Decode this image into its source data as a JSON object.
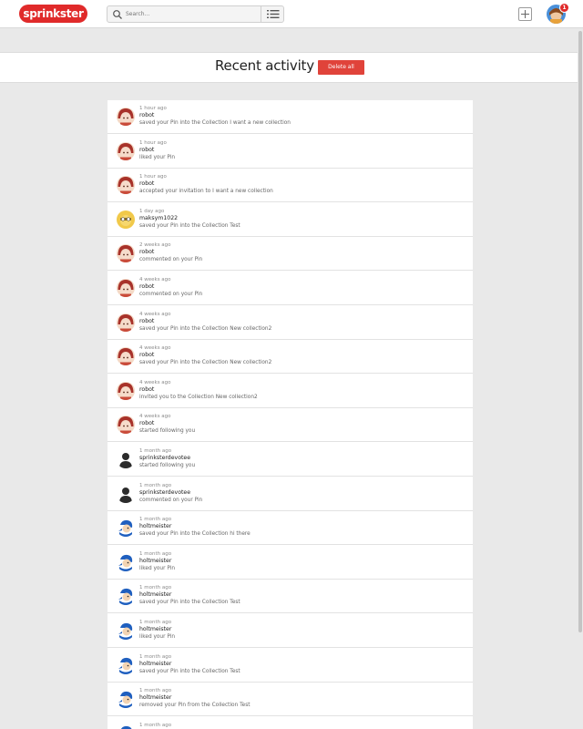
{
  "header": {
    "logo": "sprinkster",
    "search_placeholder": "Search...",
    "notification_count": "1"
  },
  "page": {
    "title": "Recent activity",
    "delete_all_label": "Delete all"
  },
  "activities": [
    {
      "time": "1 hour ago",
      "user": "robot",
      "action": "saved your Pin into the Collection I want a new collection",
      "avatar": "robot-avatar"
    },
    {
      "time": "1 hour ago",
      "user": "robot",
      "action": "liked your Pin",
      "avatar": "robot-avatar"
    },
    {
      "time": "1 hour ago",
      "user": "robot",
      "action": "accepted your invitation to I want a new collection",
      "avatar": "robot-avatar"
    },
    {
      "time": "1 day ago",
      "user": "maksym1022",
      "action": "saved your Pin into the Collection Test",
      "avatar": "maksym-avatar"
    },
    {
      "time": "2 weeks ago",
      "user": "robot",
      "action": "commented on your Pin",
      "avatar": "robot-avatar"
    },
    {
      "time": "4 weeks ago",
      "user": "robot",
      "action": "commented on your Pin",
      "avatar": "robot-avatar"
    },
    {
      "time": "4 weeks ago",
      "user": "robot",
      "action": "saved your Pin into the Collection New collection2",
      "avatar": "robot-avatar"
    },
    {
      "time": "4 weeks ago",
      "user": "robot",
      "action": "saved your Pin into the Collection New collection2",
      "avatar": "robot-avatar"
    },
    {
      "time": "4 weeks ago",
      "user": "robot",
      "action": "invited you to the Collection New collection2",
      "avatar": "robot-avatar"
    },
    {
      "time": "4 weeks ago",
      "user": "robot",
      "action": "started following you",
      "avatar": "robot-avatar"
    },
    {
      "time": "1 month ago",
      "user": "sprinksterdevotee",
      "action": "started following you",
      "avatar": "silhouette-avatar"
    },
    {
      "time": "1 month ago",
      "user": "sprinksterdevotee",
      "action": "commented on your Pin",
      "avatar": "silhouette-avatar"
    },
    {
      "time": "1 month ago",
      "user": "holtmeister",
      "action": "saved your Pin into the Collection hi there",
      "avatar": "holtmeister-avatar"
    },
    {
      "time": "1 month ago",
      "user": "holtmeister",
      "action": "liked your Pin",
      "avatar": "holtmeister-avatar"
    },
    {
      "time": "1 month ago",
      "user": "holtmeister",
      "action": "saved your Pin into the Collection Test",
      "avatar": "holtmeister-avatar"
    },
    {
      "time": "1 month ago",
      "user": "holtmeister",
      "action": "liked your Pin",
      "avatar": "holtmeister-avatar"
    },
    {
      "time": "1 month ago",
      "user": "holtmeister",
      "action": "saved your Pin into the Collection Test",
      "avatar": "holtmeister-avatar"
    },
    {
      "time": "1 month ago",
      "user": "holtmeister",
      "action": "removed your Pin from the Collection Test",
      "avatar": "holtmeister-avatar"
    },
    {
      "time": "1 month ago",
      "user": "",
      "action": "",
      "avatar": "holtmeister-avatar"
    }
  ],
  "colors": {
    "brand": "#e02a2a",
    "delete_button": "#e0433a",
    "background": "#e9e9e9"
  }
}
